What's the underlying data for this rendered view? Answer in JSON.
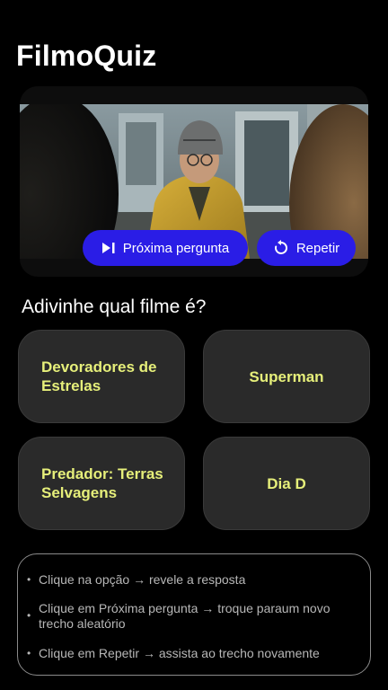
{
  "app": {
    "title": "FilmoQuiz"
  },
  "player": {
    "next_label": "Próxima pergunta",
    "repeat_label": "Repetir"
  },
  "quiz": {
    "question": "Adivinhe qual filme é?",
    "options": [
      {
        "label": "Devoradores de Estrelas"
      },
      {
        "label": "Superman"
      },
      {
        "label": "Predador: Terras Selvagens"
      },
      {
        "label": "Dia D"
      }
    ]
  },
  "help": {
    "items": [
      {
        "text": "Clique na opção → revele a resposta"
      },
      {
        "text": "Clique em Próxima pergunta → troque paraum novo trecho aleatório"
      },
      {
        "text": "Clique em Repetir → assista ao trecho novamente"
      }
    ]
  },
  "colors": {
    "accent": "#2a1de6",
    "option_text": "#e6ef7a",
    "option_bg": "#2a2a2a",
    "background": "#000000"
  },
  "icons": {
    "next": "skip-next-icon",
    "repeat": "replay-icon",
    "bullet": "bullet-icon"
  }
}
